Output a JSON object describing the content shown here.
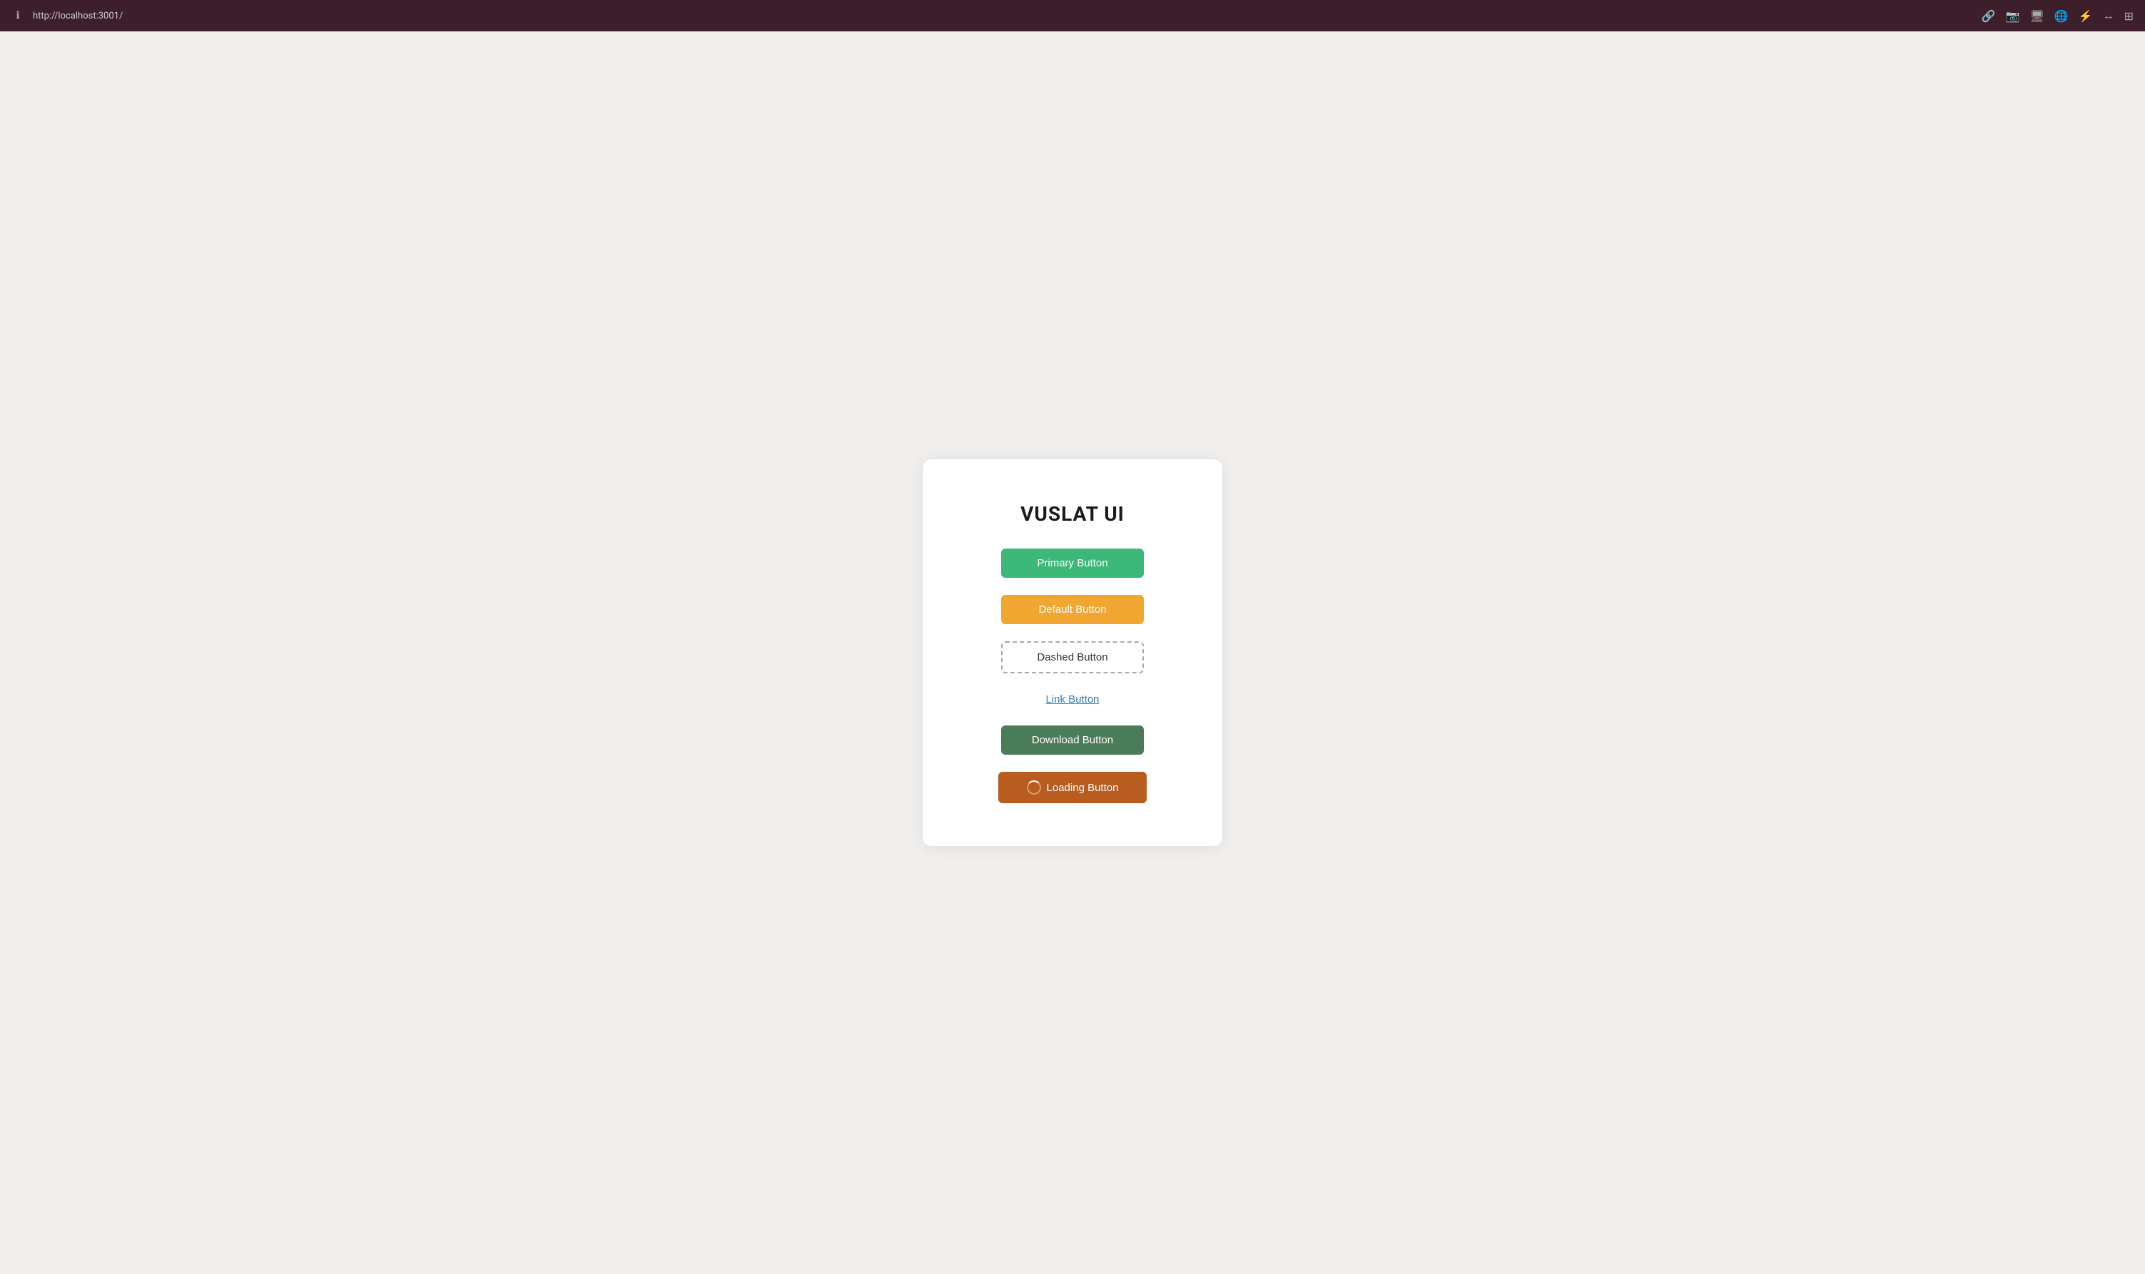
{
  "browser": {
    "url": "http://localhost:3001/",
    "info_icon": "ℹ",
    "icons": [
      "🔗",
      "📷",
      "🖥",
      "🌐",
      "⚡",
      "↔",
      "⊞"
    ]
  },
  "card": {
    "title": "VUSLAT UI",
    "buttons": {
      "primary": {
        "label": "Primary Button",
        "type": "primary"
      },
      "default": {
        "label": "Default Button",
        "type": "default"
      },
      "dashed": {
        "label": "Dashed Button",
        "type": "dashed"
      },
      "link": {
        "label": "Link Button",
        "type": "link"
      },
      "download": {
        "label": "Download Button",
        "type": "download"
      },
      "loading": {
        "label": "Loading Button",
        "type": "loading"
      }
    }
  }
}
